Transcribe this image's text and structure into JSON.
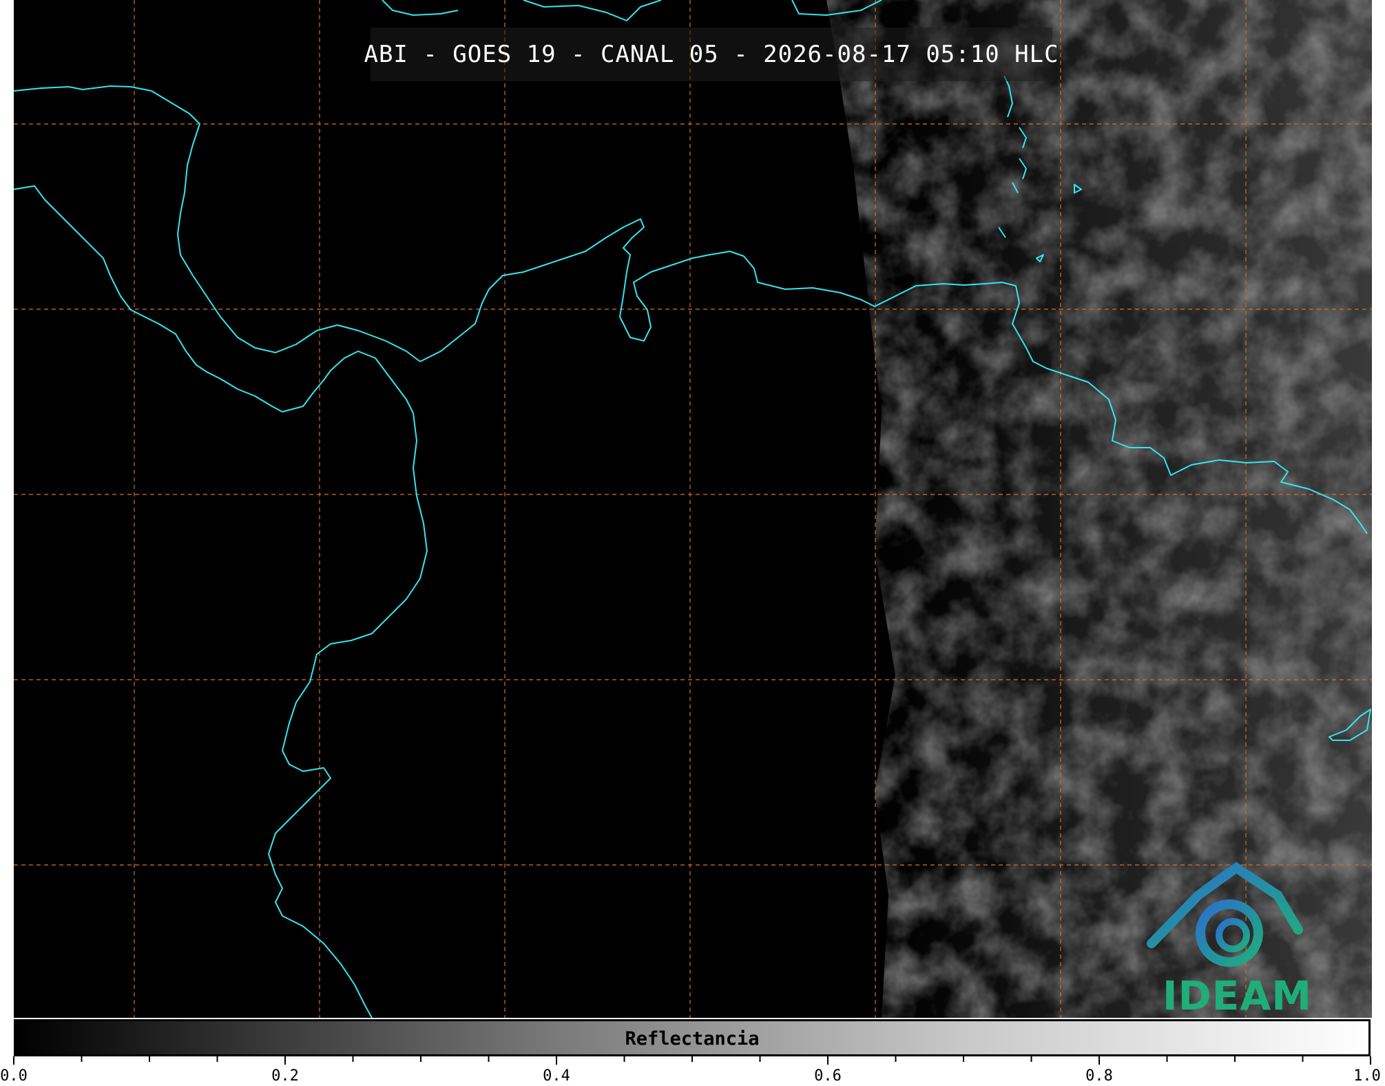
{
  "title": "ABI - GOES 19 - CANAL 05 - 2026-08-17 05:10 HLC",
  "colorbar": {
    "label": "Reflectancia",
    "min": 0.0,
    "max": 1.0,
    "tick_labels": [
      "0.0",
      "0.2",
      "0.4",
      "0.6",
      "0.8",
      "1.0"
    ],
    "colormap": [
      "#000000",
      "#ffffff"
    ]
  },
  "logo": {
    "text": "IDEAM",
    "color": "#1fae7a",
    "accent_color": "#2b6fd0"
  },
  "map": {
    "coastline_color": "#33e6f0",
    "grid_color": "#d06a26",
    "background": "#000000"
  }
}
